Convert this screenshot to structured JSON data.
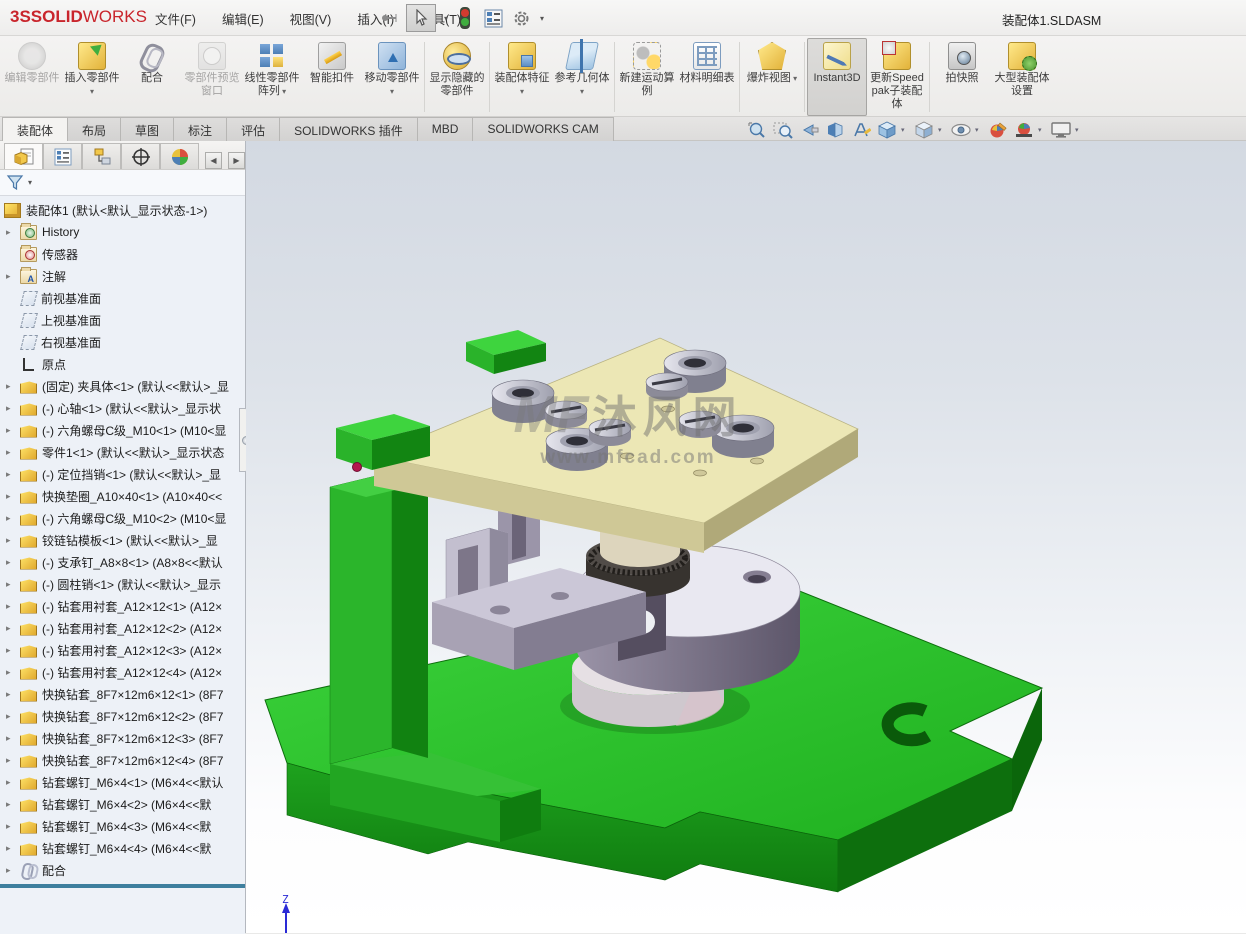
{
  "window": {
    "title": "装配体1.SLDASM",
    "logo_ds": "3S",
    "logo_solid": "SOLID",
    "logo_works": "WORKS"
  },
  "menubar": {
    "items": [
      {
        "label": "文件(F)"
      },
      {
        "label": "编辑(E)"
      },
      {
        "label": "视图(V)"
      },
      {
        "label": "插入(I)"
      },
      {
        "label": "工具(T)"
      }
    ],
    "icons": [
      "pin-icon",
      "select-cursor-icon",
      "traffic-light-icon",
      "report-icon",
      "gear-icon"
    ]
  },
  "ribbon": {
    "buttons": [
      {
        "label": "编辑零部件",
        "icon": "ic-edit",
        "state": "disabled",
        "caret": "",
        "sep": false
      },
      {
        "label": "插入零部件",
        "icon": "ic-insert",
        "state": "",
        "caret": "has-caret",
        "sep": false
      },
      {
        "label": "配合",
        "icon": "ic-mate",
        "state": "",
        "caret": "",
        "sep": false
      },
      {
        "label": "零部件预览窗口",
        "icon": "ic-preview",
        "state": "disabled",
        "caret": "",
        "sep": false
      },
      {
        "label": "线性零部件阵列",
        "icon": "ic-pattern",
        "state": "",
        "caret": "has-caret",
        "sep": false
      },
      {
        "label": "智能扣件",
        "icon": "ic-fastener",
        "state": "",
        "caret": "",
        "sep": false
      },
      {
        "label": "移动零部件",
        "icon": "ic-move",
        "state": "",
        "caret": "has-caret",
        "sep": true
      },
      {
        "label": "显示隐藏的零部件",
        "icon": "ic-showhide",
        "state": "",
        "caret": "",
        "sep": true
      },
      {
        "label": "装配体特征",
        "icon": "ic-asmfeat",
        "state": "",
        "caret": "has-caret",
        "sep": false
      },
      {
        "label": "参考几何体",
        "icon": "ic-refgeo",
        "state": "",
        "caret": "has-caret",
        "sep": true
      },
      {
        "label": "新建运动算例",
        "icon": "ic-motion",
        "state": "",
        "caret": "",
        "sep": false
      },
      {
        "label": "材料明细表",
        "icon": "ic-bom",
        "state": "",
        "caret": "",
        "sep": true
      },
      {
        "label": "爆炸视图",
        "icon": "ic-explode",
        "state": "",
        "caret": "has-caret",
        "sep": true
      },
      {
        "label": "Instant3D",
        "icon": "ic-instant3d",
        "state": "active",
        "caret": "",
        "sep": false
      },
      {
        "label": "更新Speedpak子装配体",
        "icon": "ic-speedpak",
        "state": "",
        "caret": "",
        "sep": true
      },
      {
        "label": "拍快照",
        "icon": "ic-snapshot",
        "state": "",
        "caret": "",
        "sep": false
      },
      {
        "label": "大型装配体设置",
        "icon": "ic-largeasm",
        "state": "",
        "caret": "",
        "sep": false
      }
    ]
  },
  "tabs": {
    "items": [
      {
        "label": "装配体",
        "state": "active"
      },
      {
        "label": "布局",
        "state": ""
      },
      {
        "label": "草图",
        "state": ""
      },
      {
        "label": "标注",
        "state": ""
      },
      {
        "label": "评估",
        "state": ""
      },
      {
        "label": "SOLIDWORKS 插件",
        "state": ""
      },
      {
        "label": "MBD",
        "state": ""
      },
      {
        "label": "SOLIDWORKS CAM",
        "state": ""
      }
    ]
  },
  "headsup": {
    "icons": [
      "zoom-fit-icon",
      "zoom-area-icon",
      "previous-view-icon",
      "section-view-icon",
      "annotation-visibility-icon",
      "view-orientation-icon",
      "display-style-icon",
      "hide-show-items-icon",
      "edit-appearance-icon",
      "apply-scene-icon",
      "view-settings-icon"
    ]
  },
  "panel": {
    "tabs": [
      "featuremanager-tab",
      "propertymanager-tab",
      "configurationmanager-tab",
      "dimxpertmanager-tab",
      "displaymanager-tab"
    ],
    "tree": [
      {
        "label": "装配体1 (默认<默认_显示状态-1>)",
        "icon": "ti-asm",
        "arrow": false,
        "root": true
      },
      {
        "label": "History",
        "icon": "ti-folder ti-history",
        "arrow": true
      },
      {
        "label": "传感器",
        "icon": "ti-folder ti-sensor",
        "arrow": false
      },
      {
        "label": "注解",
        "icon": "ti-folder ti-anno",
        "arrow": true
      },
      {
        "label": "前视基准面",
        "icon": "ti-plane",
        "arrow": false
      },
      {
        "label": "上视基准面",
        "icon": "ti-plane",
        "arrow": false
      },
      {
        "label": "右视基准面",
        "icon": "ti-plane",
        "arrow": false
      },
      {
        "label": "原点",
        "icon": "ti-origin",
        "arrow": false
      },
      {
        "label": "(固定) 夹具体<1> (默认<<默认>_显",
        "icon": "ti-part",
        "arrow": true
      },
      {
        "label": "(-) 心轴<1> (默认<<默认>_显示状",
        "icon": "ti-part",
        "arrow": true
      },
      {
        "label": "(-) 六角螺母C级_M10<1> (M10<显",
        "icon": "ti-part",
        "arrow": true
      },
      {
        "label": "零件1<1> (默认<<默认>_显示状态",
        "icon": "ti-part",
        "arrow": true
      },
      {
        "label": "(-) 定位挡销<1> (默认<<默认>_显",
        "icon": "ti-part",
        "arrow": true
      },
      {
        "label": "快换垫圈_A10×40<1> (A10×40<<",
        "icon": "ti-part",
        "arrow": true
      },
      {
        "label": "(-) 六角螺母C级_M10<2> (M10<显",
        "icon": "ti-part",
        "arrow": true
      },
      {
        "label": "铰链钻模板<1> (默认<<默认>_显",
        "icon": "ti-part",
        "arrow": true
      },
      {
        "label": "(-) 支承钉_A8×8<1> (A8×8<<默认",
        "icon": "ti-part",
        "arrow": true
      },
      {
        "label": "(-) 圆柱销<1> (默认<<默认>_显示",
        "icon": "ti-part",
        "arrow": true
      },
      {
        "label": "(-) 钻套用衬套_A12×12<1> (A12×",
        "icon": "ti-part",
        "arrow": true
      },
      {
        "label": "(-) 钻套用衬套_A12×12<2> (A12×",
        "icon": "ti-part",
        "arrow": true
      },
      {
        "label": "(-) 钻套用衬套_A12×12<3> (A12×",
        "icon": "ti-part",
        "arrow": true
      },
      {
        "label": "(-) 钻套用衬套_A12×12<4> (A12×",
        "icon": "ti-part",
        "arrow": true
      },
      {
        "label": "快换钻套_8F7×12m6×12<1> (8F7",
        "icon": "ti-part",
        "arrow": true
      },
      {
        "label": "快换钻套_8F7×12m6×12<2> (8F7",
        "icon": "ti-part",
        "arrow": true
      },
      {
        "label": "快换钻套_8F7×12m6×12<3> (8F7",
        "icon": "ti-part",
        "arrow": true
      },
      {
        "label": "快换钻套_8F7×12m6×12<4> (8F7",
        "icon": "ti-part",
        "arrow": true
      },
      {
        "label": "钻套螺钉_M6×4<1> (M6×4<<默认",
        "icon": "ti-part",
        "arrow": true
      },
      {
        "label": "钻套螺钉_M6×4<2> (M6×4<<默",
        "icon": "ti-part",
        "arrow": true
      },
      {
        "label": "钻套螺钉_M6×4<3> (M6×4<<默",
        "icon": "ti-part",
        "arrow": true
      },
      {
        "label": "钻套螺钉_M6×4<4> (M6×4<<默",
        "icon": "ti-part",
        "arrow": true
      },
      {
        "label": "配合",
        "icon": "ti-mate",
        "arrow": true
      }
    ],
    "rollback_color": "#3e7f9e"
  },
  "viewport": {
    "watermark": {
      "logo": "MF",
      "name": "沐风网",
      "url": "www.mfcad.com"
    },
    "triad_z": "Z",
    "model_colors": {
      "base_green": "#2fc82f",
      "plate_tan": "#ece7b5",
      "metal_gray": "#8d8698",
      "knurl_dark": "#37332f",
      "pin_red": "#b3174e"
    }
  }
}
